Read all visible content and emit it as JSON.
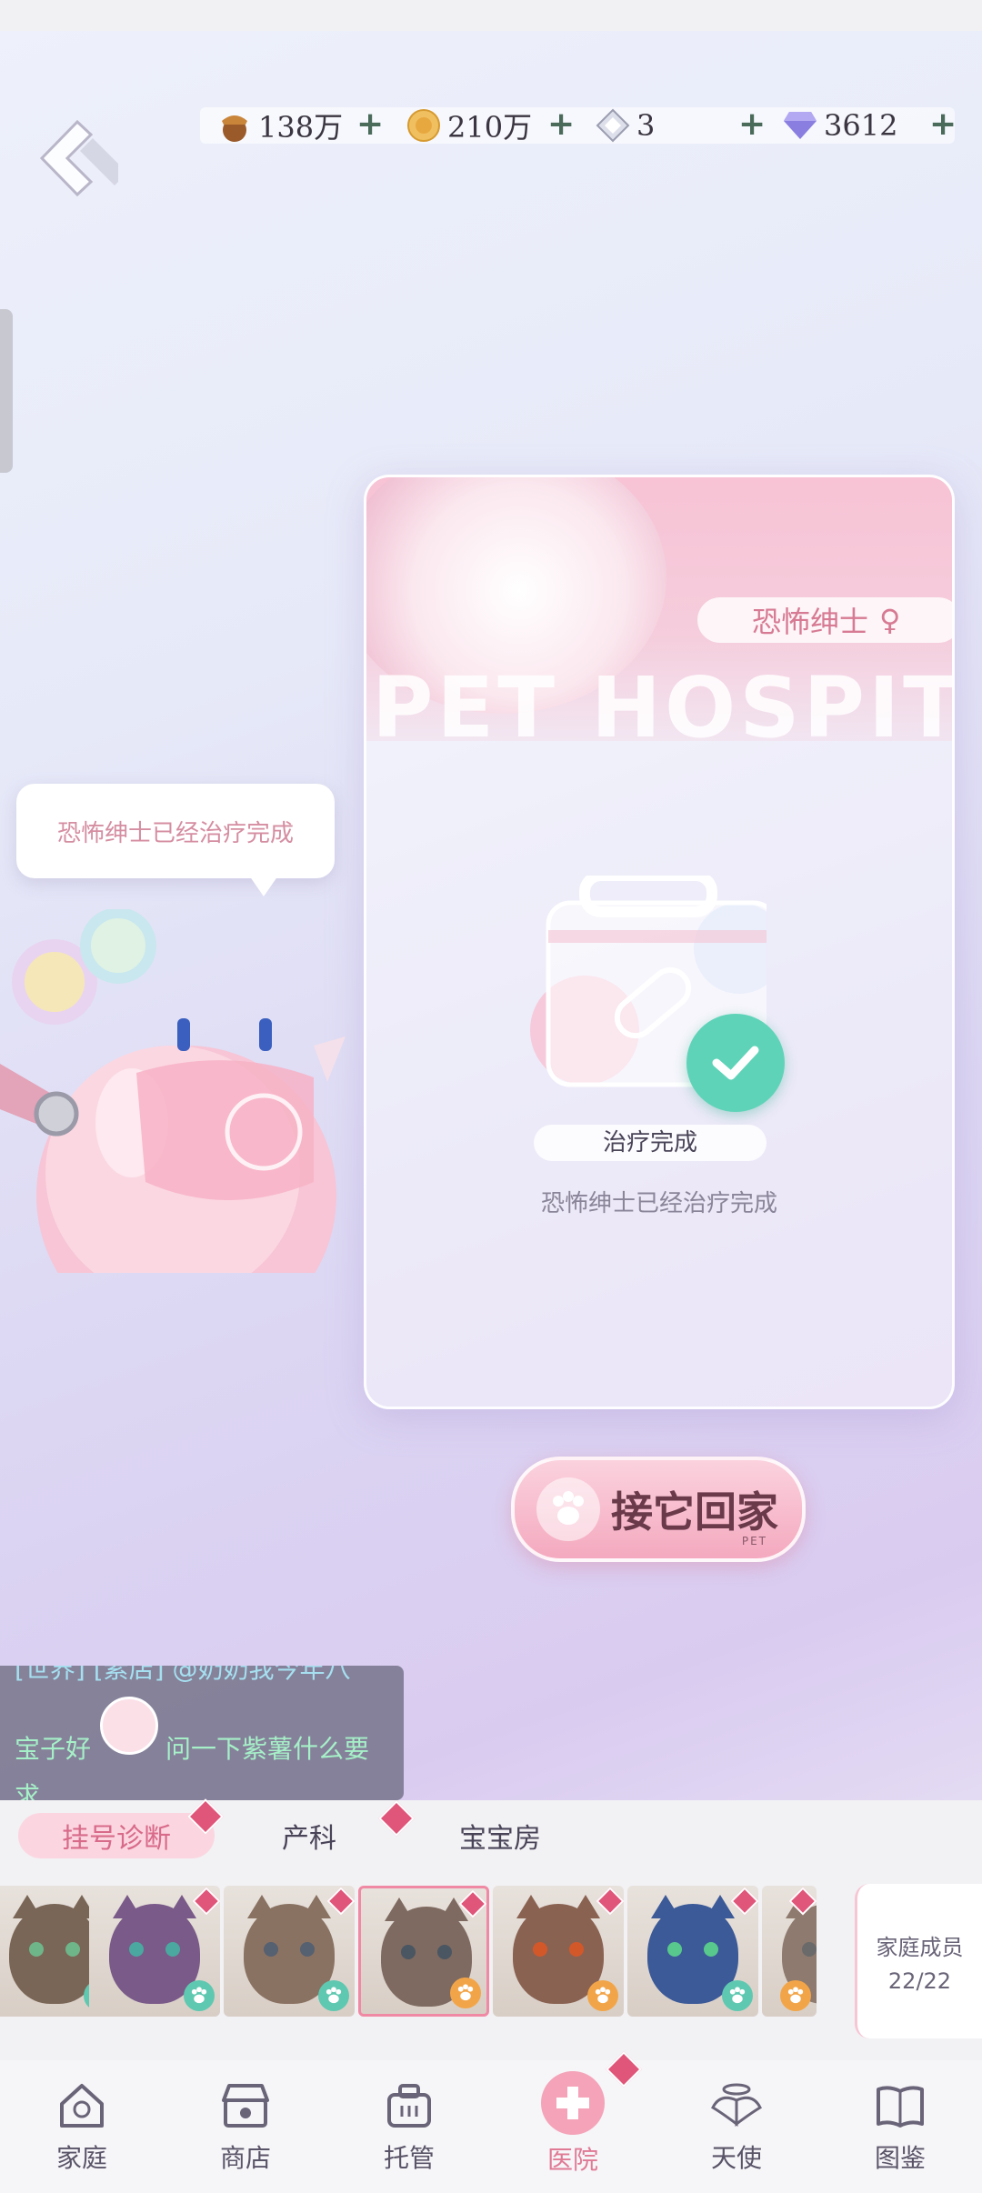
{
  "currencies": [
    {
      "icon": "acorn-icon",
      "value": "138万"
    },
    {
      "icon": "gold-coin-icon",
      "value": "210万"
    },
    {
      "icon": "crystal-icon",
      "value": "3"
    },
    {
      "icon": "diamond-icon",
      "value": "3612"
    }
  ],
  "plus_label": "+",
  "card": {
    "watermark": "PET HOSPITAL",
    "pet_name": "恐怖绅士",
    "status_label": "治疗完成",
    "status_desc": "恐怖绅士已经治疗完成"
  },
  "bubble_text": "恐怖绅士已经治疗完成",
  "take_home": {
    "label": "接它回家",
    "sub": "PET"
  },
  "chat": {
    "line1": "[世界] [素店] @奶奶我今年八",
    "line2": "宝子好",
    "line2b": "问一下紫薯什么要",
    "line3": "求"
  },
  "tabs": [
    {
      "label": "挂号诊断",
      "active": true
    },
    {
      "label": "产科",
      "active": false
    },
    {
      "label": "宝宝房",
      "active": false
    }
  ],
  "cats": [
    {
      "fur": "#7a6656",
      "eye": "#6fb58a",
      "paw": "#5fc8b0"
    },
    {
      "fur": "#7a5a88",
      "eye": "#4aa8a0",
      "paw": "#5fc8b0"
    },
    {
      "fur": "#8a7262",
      "eye": "#556070",
      "paw": "#5fc8b0"
    },
    {
      "fur": "#7e6a60",
      "eye": "#4a5662",
      "paw": "#f2a548",
      "selected": true
    },
    {
      "fur": "#8a6252",
      "eye": "#d2582a",
      "paw": "#f2a548"
    },
    {
      "fur": "#3c5a98",
      "eye": "#58c88c",
      "paw": "#5fc8b0"
    },
    {
      "fur": "#8e7a6e",
      "eye": "#6a6a6a",
      "paw": "#f2a548"
    }
  ],
  "family": {
    "label": "家庭成员",
    "count": "22/22"
  },
  "nav": [
    {
      "label": "家庭",
      "icon": "house-icon"
    },
    {
      "label": "商店",
      "icon": "shop-icon"
    },
    {
      "label": "托管",
      "icon": "briefcase-icon"
    },
    {
      "label": "医院",
      "icon": "hospital-cross-icon",
      "active": true
    },
    {
      "label": "天使",
      "icon": "angel-wings-icon"
    },
    {
      "label": "图鉴",
      "icon": "book-icon"
    }
  ],
  "colors": {
    "accent_pink": "#f4a3b8",
    "check_green": "#5fd3b8"
  }
}
